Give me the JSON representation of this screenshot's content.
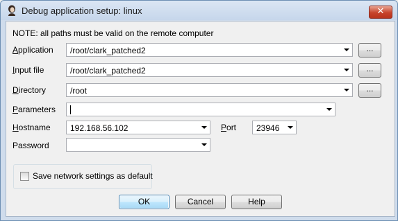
{
  "window": {
    "title": "Debug application setup: linux",
    "close_label": "✕",
    "app_icon": "ida-lady-icon"
  },
  "note": "NOTE: all paths must be valid on the remote computer",
  "fields": {
    "application": {
      "label_key": "A",
      "label_rest": "pplication",
      "value": "/root/clark_patched2",
      "browse_label": "..."
    },
    "input_file": {
      "label_key": "I",
      "label_rest": "nput file",
      "value": "/root/clark_patched2",
      "browse_label": "..."
    },
    "directory": {
      "label_key": "D",
      "label_rest": "irectory",
      "value": "/root",
      "browse_label": "..."
    },
    "parameters": {
      "label_key": "P",
      "label_rest": "arameters",
      "value": ""
    },
    "hostname": {
      "label_key": "H",
      "label_rest": "ostname",
      "value": "192.168.56.102"
    },
    "port": {
      "label_key": "P",
      "label_rest": "ort",
      "value": "23946"
    },
    "password": {
      "label_key": "",
      "label_rest": "Password",
      "value": ""
    }
  },
  "save_settings": {
    "label": "Save network settings as default",
    "checked": false
  },
  "buttons": {
    "ok": "OK",
    "cancel": "Cancel",
    "help": "Help"
  }
}
